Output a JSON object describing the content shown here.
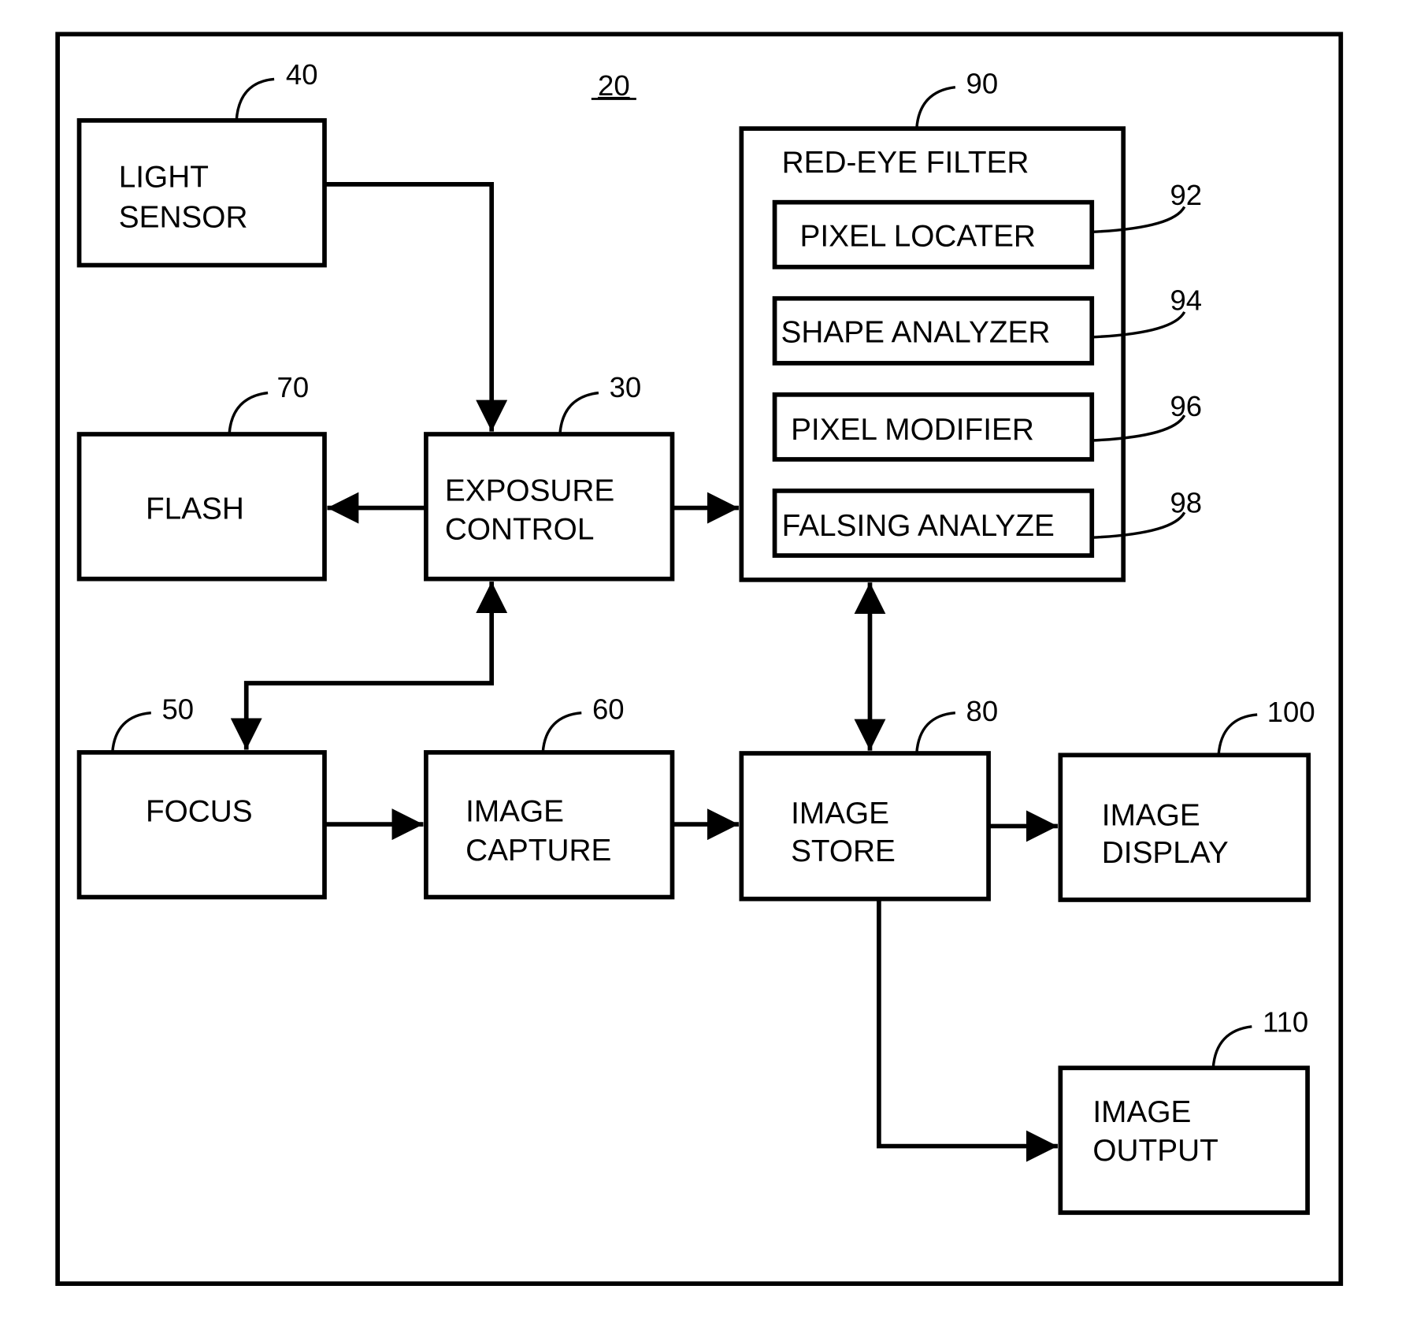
{
  "figure": {
    "ref": "20"
  },
  "blocks": {
    "light_sensor": {
      "ref": "40",
      "line1": "LIGHT",
      "line2": "SENSOR"
    },
    "flash": {
      "ref": "70",
      "line1": "FLASH"
    },
    "exposure_control": {
      "ref": "30",
      "line1": "EXPOSURE",
      "line2": "CONTROL"
    },
    "red_eye_filter": {
      "ref": "90",
      "title": "RED-EYE FILTER",
      "sub": [
        {
          "ref": "92",
          "label": "PIXEL LOCATER"
        },
        {
          "ref": "94",
          "label": "SHAPE ANALYZER"
        },
        {
          "ref": "96",
          "label": "PIXEL MODIFIER"
        },
        {
          "ref": "98",
          "label": "FALSING ANALYZE"
        }
      ]
    },
    "focus": {
      "ref": "50",
      "line1": "FOCUS"
    },
    "image_capture": {
      "ref": "60",
      "line1": "IMAGE",
      "line2": "CAPTURE"
    },
    "image_store": {
      "ref": "80",
      "line1": "IMAGE",
      "line2": "STORE"
    },
    "image_display": {
      "ref": "100",
      "line1": "IMAGE",
      "line2": "DISPLAY"
    },
    "image_output": {
      "ref": "110",
      "line1": "IMAGE",
      "line2": "OUTPUT"
    }
  }
}
